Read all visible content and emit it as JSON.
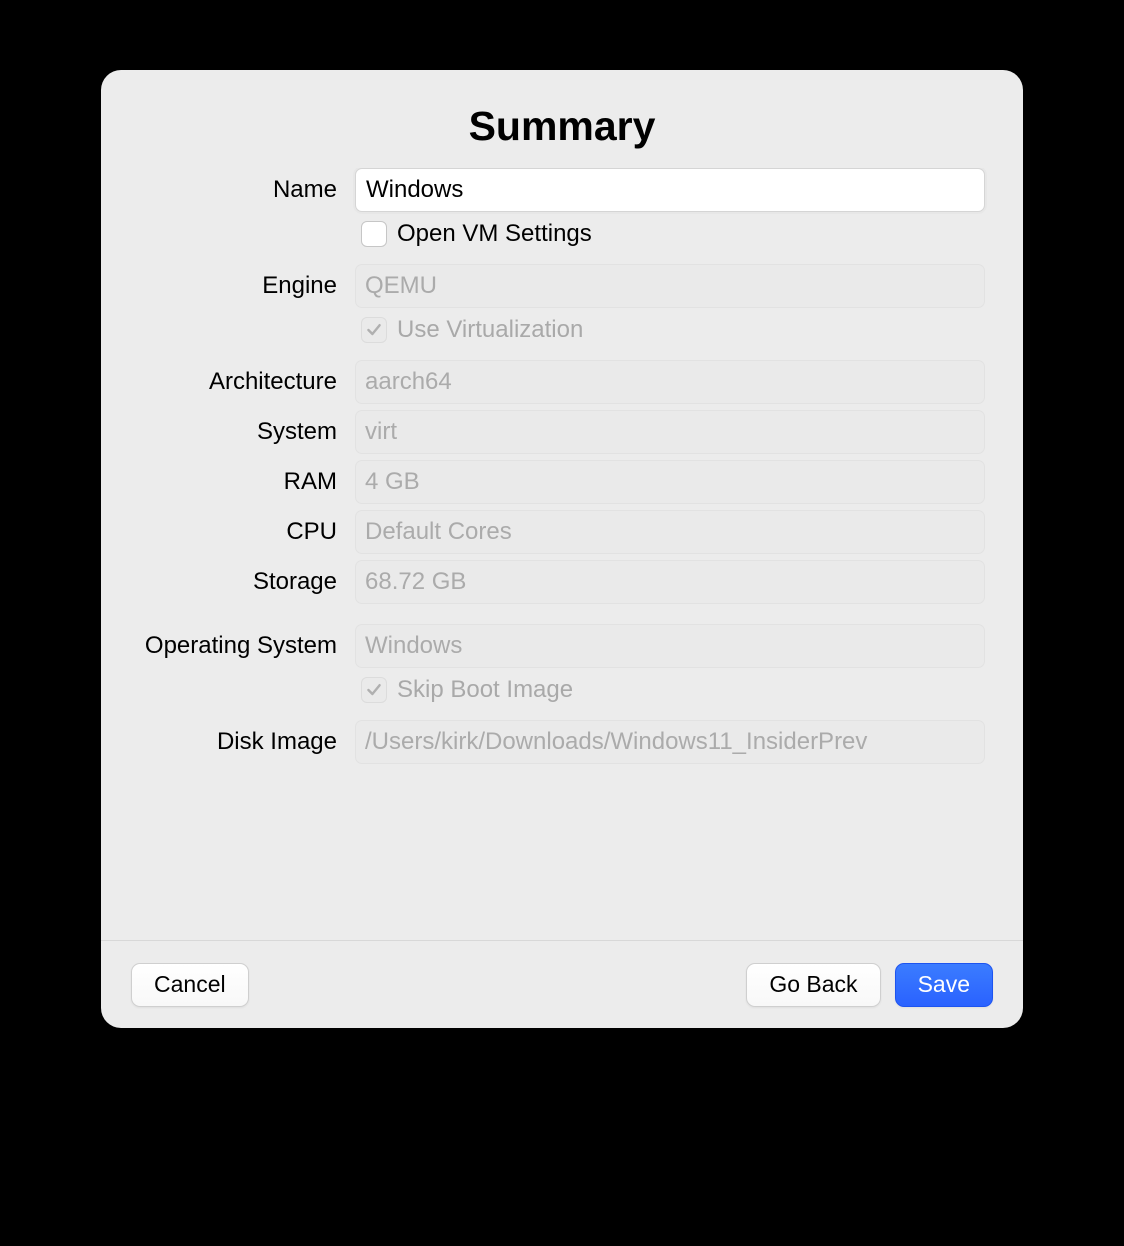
{
  "title": "Summary",
  "form": {
    "name_label": "Name",
    "name_value": "Windows",
    "open_vm_settings_label": "Open VM Settings",
    "open_vm_settings_checked": false,
    "engine_label": "Engine",
    "engine_value": "QEMU",
    "use_virtualization_label": "Use Virtualization",
    "use_virtualization_checked": true,
    "architecture_label": "Architecture",
    "architecture_value": "aarch64",
    "system_label": "System",
    "system_value": "virt",
    "ram_label": "RAM",
    "ram_value": "4 GB",
    "cpu_label": "CPU",
    "cpu_value": "Default Cores",
    "storage_label": "Storage",
    "storage_value": "68.72 GB",
    "os_label": "Operating System",
    "os_value": "Windows",
    "skip_boot_label": "Skip Boot Image",
    "skip_boot_checked": true,
    "disk_image_label": "Disk Image",
    "disk_image_value": "/Users/kirk/Downloads/Windows11_InsiderPrev"
  },
  "buttons": {
    "cancel": "Cancel",
    "go_back": "Go Back",
    "save": "Save"
  }
}
